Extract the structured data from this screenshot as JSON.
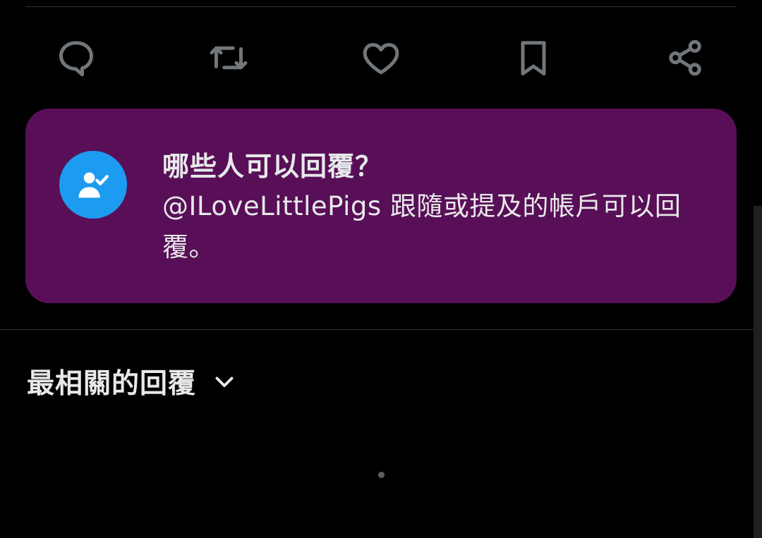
{
  "actions": {
    "reply_icon": "comment-bubble-icon",
    "retweet_icon": "repost-arrows-icon",
    "like_icon": "heart-icon",
    "bookmark_icon": "bookmark-icon",
    "share_icon": "share-nodes-icon"
  },
  "reply_restriction_card": {
    "title": "哪些人可以回覆？",
    "body": "@ILoveLittlePigs 跟隨或提及的帳戶可以回覆。",
    "icon": "user-check-icon",
    "background_color": "#580f57",
    "icon_background_color": "#1d9bf0"
  },
  "replies_sort": {
    "label": "最相關的回覆",
    "icon": "chevron-down-icon"
  },
  "colors": {
    "background": "#000000",
    "icon_gray": "#71767b",
    "text": "#e7e9ea",
    "divider": "#2f3336"
  }
}
